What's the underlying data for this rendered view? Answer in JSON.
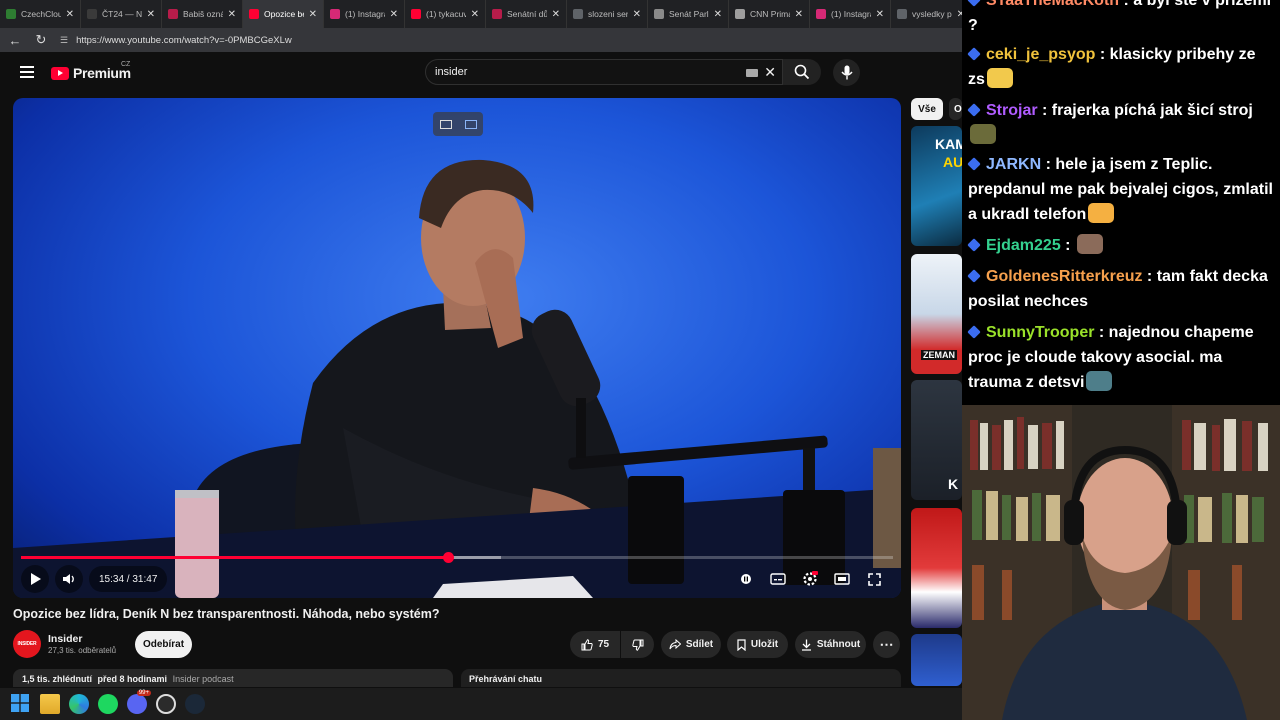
{
  "browser": {
    "tabs": [
      {
        "label": "CzechClouds",
        "favicon_color": "#2e7d32",
        "active": false
      },
      {
        "label": "ČT24 — Nejdůležitější",
        "favicon_color": "#3a3a3a",
        "active": false
      },
      {
        "label": "Babiš oznámil",
        "favicon_color": "#b71c4a",
        "active": false
      },
      {
        "label": "Opozice bez lídra",
        "favicon_color": "#ff0033",
        "active": true
      },
      {
        "label": "(1) Instagram",
        "favicon_color": "#d62976",
        "active": false
      },
      {
        "label": "(1) tykacuv",
        "favicon_color": "#ff0033",
        "active": false
      },
      {
        "label": "Senátní dům",
        "favicon_color": "#b71c4a",
        "active": false
      },
      {
        "label": "slozeni senatu",
        "favicon_color": "#5f6368",
        "active": false
      },
      {
        "label": "Senát Parlamentu",
        "favicon_color": "#8a8a8a",
        "active": false
      },
      {
        "label": "CNN Prima",
        "favicon_color": "#9e9e9e",
        "active": false
      },
      {
        "label": "(1) Instagram",
        "favicon_color": "#d62976",
        "active": false
      },
      {
        "label": "vysledky pa",
        "favicon_color": "#5f6368",
        "active": false
      }
    ],
    "url": "https://www.youtube.com/watch?v=-0PMBCGeXLw"
  },
  "youtube": {
    "logo_text": "Premium",
    "logo_region": "CZ",
    "search_value": "insider",
    "video": {
      "current_time": "15:34",
      "duration": "31:47",
      "time_display": "15:34 / 31:47",
      "played_fraction": 0.49,
      "loaded_fraction": 0.55
    },
    "title": "Opozice bez lídra, Deník N bez transparentnosti. Náhoda, nebo systém?",
    "channel": {
      "name": "Insider",
      "subscribers": "27,3 tis. odběratelů",
      "avatar_text": "INSIDER",
      "subscribe_label": "Odebírat"
    },
    "actions": {
      "like_count": "75",
      "share": "Sdílet",
      "save": "Uložit",
      "download": "Stáhnout"
    },
    "description": {
      "views": "1,5 tis. zhlédnutí",
      "age": "před 8 hodinami",
      "tag": "Insider podcast"
    },
    "chat_replay": "Přehrávání chatu",
    "chips": [
      "Vše",
      "O"
    ],
    "thumb_texts": [
      "KAM",
      "AU",
      "ZEMAN",
      "K"
    ]
  },
  "chat": {
    "messages": [
      {
        "user": "STaaTheMacKoth",
        "color": "#ff8a65",
        "text": "a byl ste v prizemi ?"
      },
      {
        "user": "ceki_je_psyop",
        "color": "#f0c23c",
        "text": "klasicky pribehy ze zs"
      },
      {
        "user": "Strojar",
        "color": "#b05cff",
        "text": "frajerka píchá jak šicí stroj"
      },
      {
        "user": "JARKN",
        "color": "#8fb8ff",
        "text": "hele ja jsem z Teplic. prepdanul me pak bejvalej cigos, zmlatil a ukradl telefon"
      },
      {
        "user": "Ejdam225",
        "color": "#34d18f",
        "text": ""
      },
      {
        "user": "GoldenesRitterkreuz",
        "color": "#f6a04d",
        "text": "tam fakt decka posilat nechces"
      },
      {
        "user": "SunnyTrooper",
        "color": "#9be22a",
        "text": "najednou chapeme proc je cloude takovy asocial. ma trauma z detsvi"
      }
    ]
  },
  "taskbar": {
    "discord_badge": "99+"
  }
}
